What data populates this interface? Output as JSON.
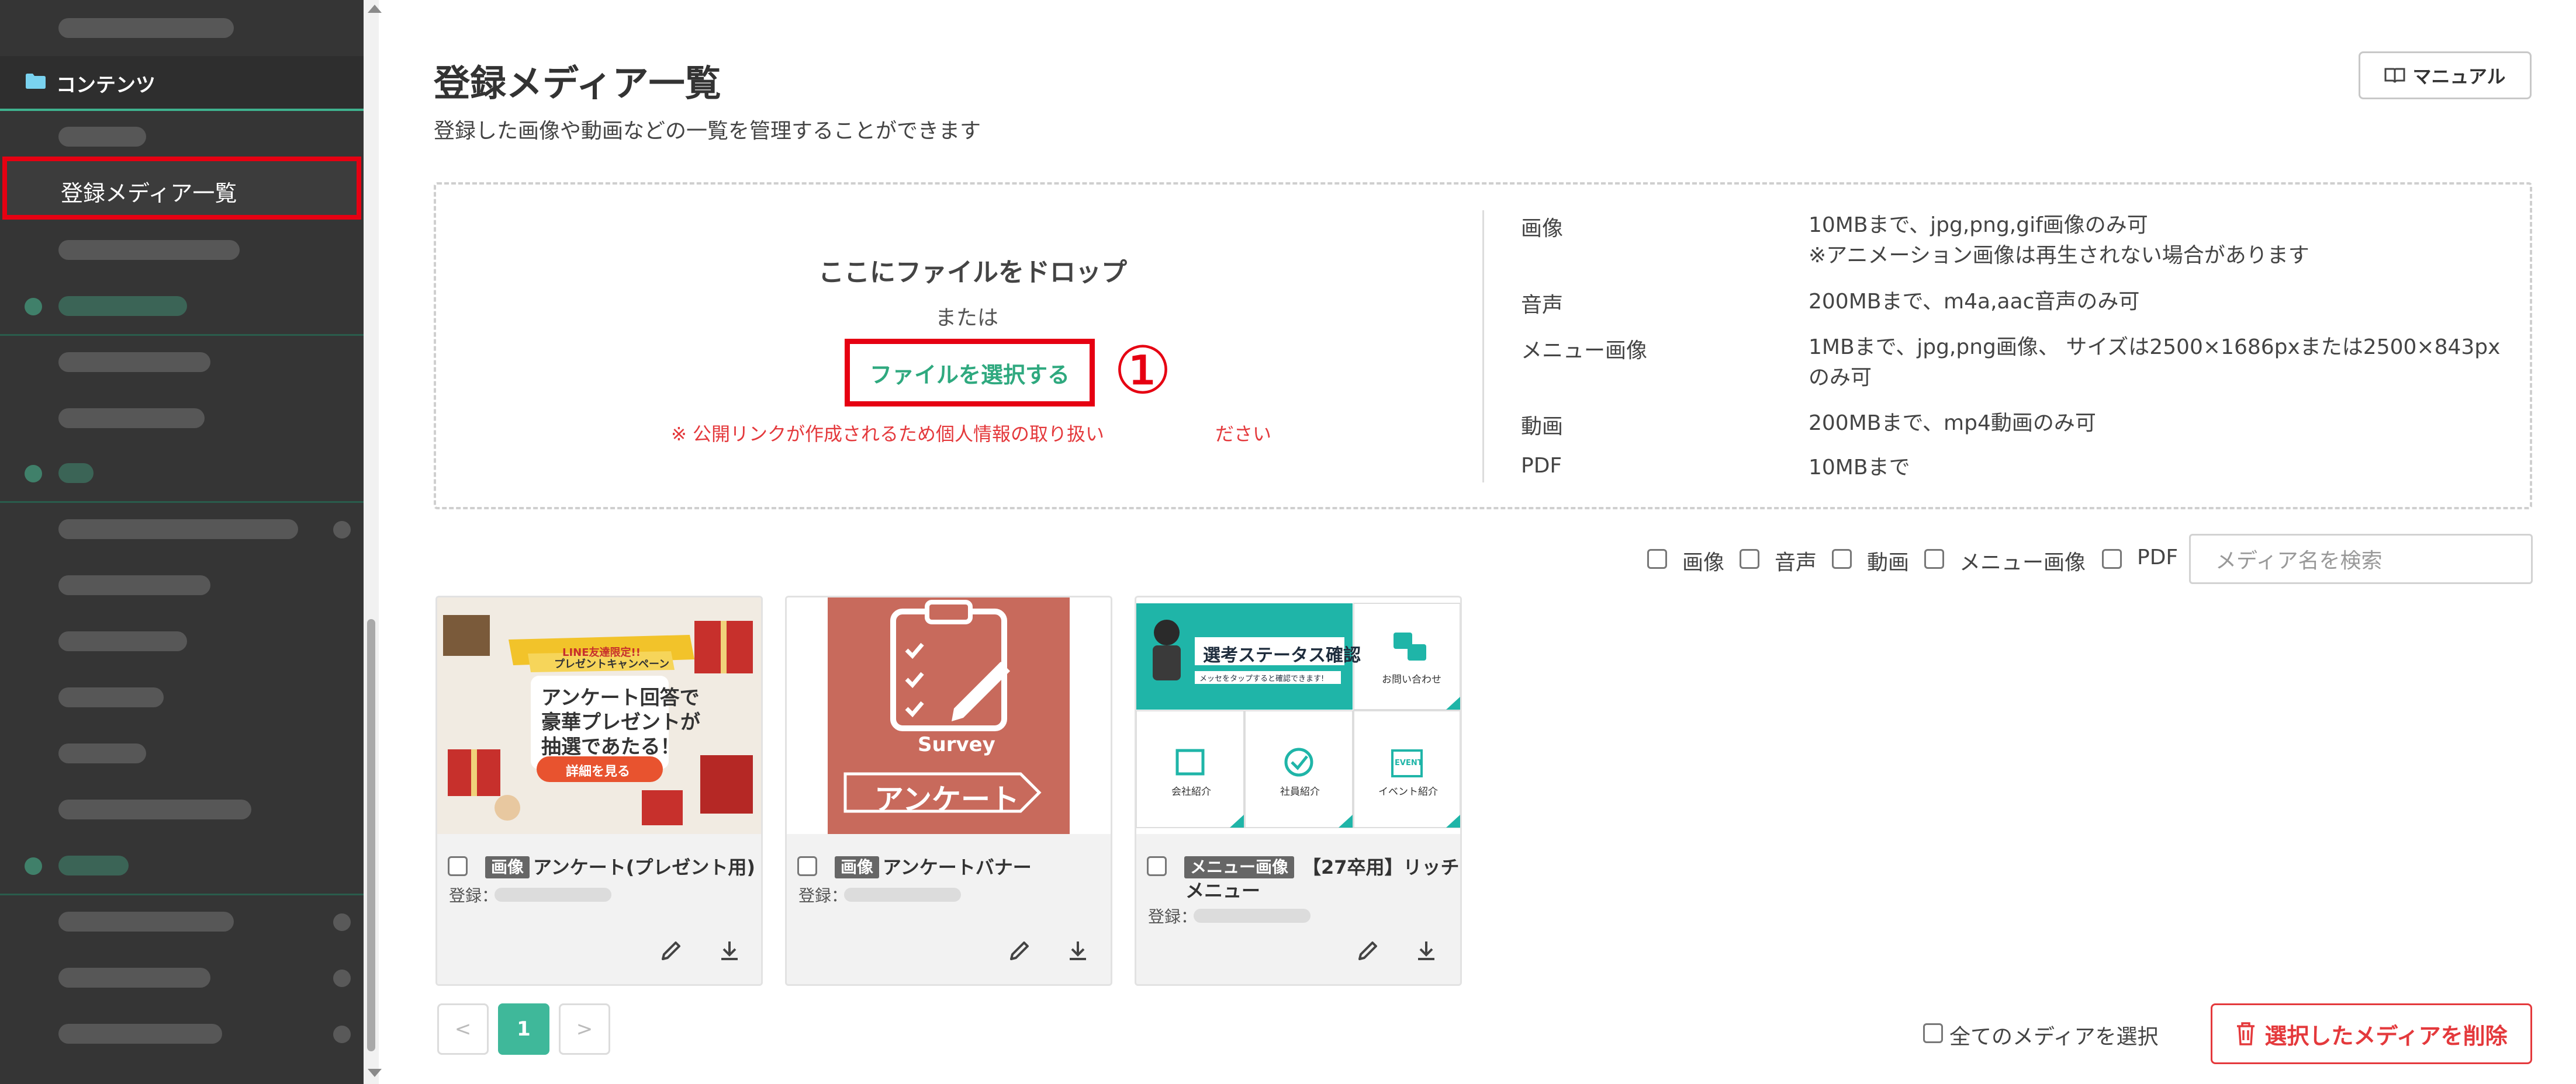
{
  "sidebar": {
    "contents_label": "コンテンツ",
    "active_label": "登録メディア一覧"
  },
  "header": {
    "title": "登録メディア一覧",
    "description": "登録した画像や動画などの一覧を管理することができます",
    "manual_label": "マニュアル"
  },
  "dropzone": {
    "title": "ここにファイルをドロップ",
    "or": "または",
    "select_label": "ファイルを選択する",
    "annotation": "①",
    "warning_left": "※ 公開リンクが作成されるため個人情報の取り扱い",
    "warning_right": "ださい",
    "specs": [
      {
        "label": "画像",
        "value": "10MBまで、jpg,png,gif画像のみ可",
        "value2": "※アニメーション画像は再生されない場合があります"
      },
      {
        "label": "音声",
        "value": "200MBまで、m4a,aac音声のみ可",
        "value2": ""
      },
      {
        "label": "メニュー画像",
        "value": "1MBまで、jpg,png画像、 サイズは2500×1686pxまたは2500×843px",
        "value2": "のみ可"
      },
      {
        "label": "動画",
        "value": "200MBまで、mp4動画のみ可",
        "value2": ""
      },
      {
        "label": "PDF",
        "value": "10MBまで",
        "value2": ""
      }
    ]
  },
  "filters": {
    "items": [
      "画像",
      "音声",
      "動画",
      "メニュー画像",
      "PDF"
    ],
    "search_placeholder": "メディア名を検索"
  },
  "cards": [
    {
      "tag": "画像",
      "name": "アンケート(プレゼント用)",
      "reg_label": "登録：",
      "thumb": {
        "l1": "LINE友達限定!!",
        "l2": "プレゼントキャンペーン",
        "l3": "アンケート回答で",
        "l4": "豪華プレゼントが",
        "l5": "抽選であたる！",
        "btn": "詳細を見る"
      }
    },
    {
      "tag": "画像",
      "name": "アンケートバナー",
      "reg_label": "登録：",
      "thumb": {
        "survey": "Survey",
        "banner": "アンケート"
      }
    },
    {
      "tag": "メニュー画像",
      "name": "【27卒用】リッチ",
      "name2": "メニュー",
      "reg_label": "登録：",
      "thumb": {
        "top": "選考ステータス確認",
        "sub": "メッセをタップすると確認できます!",
        "inquiry": "お問い合わせ",
        "company": "会社紹介",
        "staff": "社員紹介",
        "event": "イベント紹介",
        "event_icon": "EVENT"
      }
    }
  ],
  "pagination": {
    "prev": "<",
    "current": "1",
    "next": ">"
  },
  "footer": {
    "select_all_label": "全てのメディアを選択",
    "delete_label": "選択したメディアを削除"
  },
  "colors": {
    "accent": "#3fb89a",
    "danger": "#e4393c",
    "highlight": "#e60012",
    "sidebar": "#353535"
  }
}
